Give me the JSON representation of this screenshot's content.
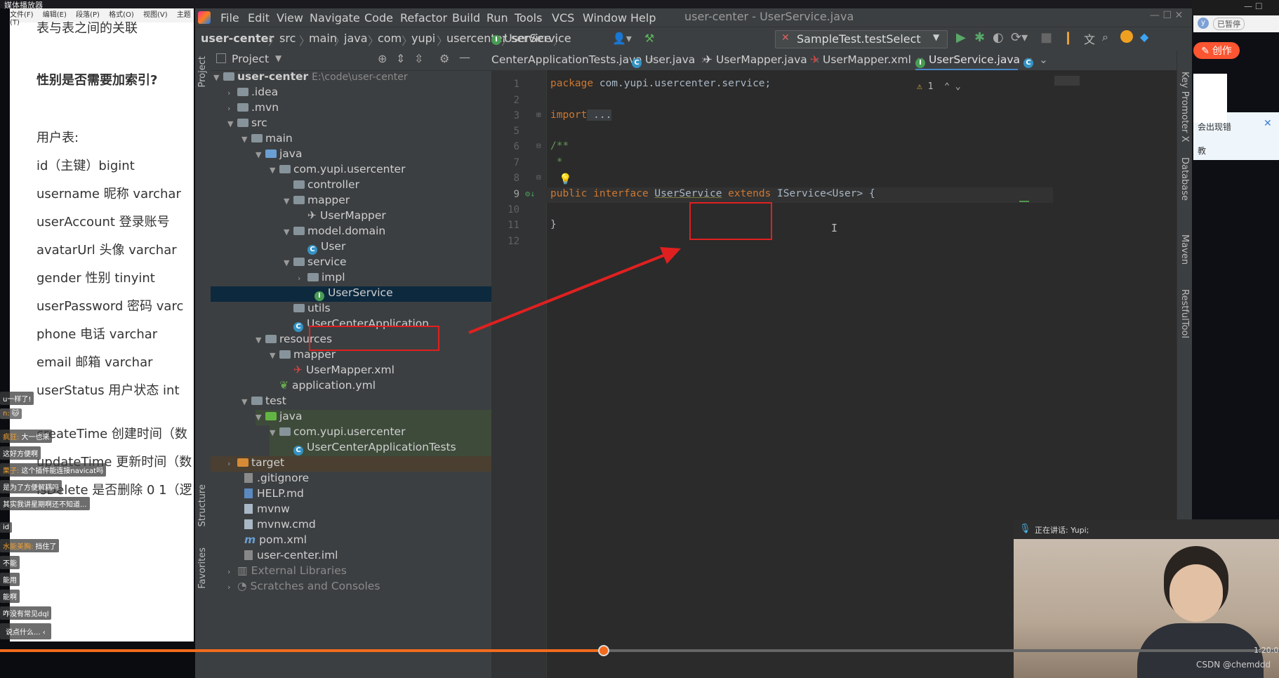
{
  "player": {
    "title": "媒体播放器"
  },
  "doc": {
    "menu": [
      "文件(F)",
      "编辑(E)",
      "段落(P)",
      "格式(O)",
      "视图(V)",
      "主题(T)"
    ],
    "heading_top": "表与表之间的关联",
    "question": "性别是否需要加索引?",
    "table_title": "用户表:",
    "fields": [
      "id（主键）bigint",
      "username 昵称  varchar",
      "userAccount 登录账号",
      "avatarUrl 头像 varchar",
      "gender 性别 tinyint",
      "userPassword 密码  varc",
      "phone 电话 varchar",
      "email 邮箱 varchar",
      "userStatus 用户状态 int",
      "createTime 创建时间（数",
      "updateTime 更新时间（数",
      "isDelete 是否删除 0 1（逻"
    ]
  },
  "danmaku": [
    {
      "text": "u一样了!"
    },
    {
      "name": "n:",
      "text": ""
    },
    {
      "name": "疯狂:",
      "text": "大一也来"
    },
    {
      "text": "这好方便啊"
    },
    {
      "name": "栗子:",
      "text": "这个插件能连接navicat吗"
    },
    {
      "text": "是为了方便解耦吗"
    },
    {
      "text": "其实我讲星期啊还不知道..."
    },
    {
      "text": "id"
    },
    {
      "name": "水能美胸:",
      "text": "挡住了"
    },
    {
      "text": "不能"
    },
    {
      "text": "能用"
    },
    {
      "text": "能啊"
    },
    {
      "text": "咋没有常见dql"
    },
    {
      "text": "说点什么..."
    }
  ],
  "ide": {
    "menu": [
      "File",
      "Edit",
      "View",
      "Navigate",
      "Code",
      "Refactor",
      "Build",
      "Run",
      "Tools",
      "VCS",
      "Window",
      "Help"
    ],
    "window_title": "user-center - UserService.java",
    "breadcrumbs": [
      "user-center",
      "src",
      "main",
      "java",
      "com",
      "yupi",
      "usercenter",
      "service",
      "UserService"
    ],
    "run_config": "SampleTest.testSelect",
    "project_label": "Project",
    "left_strip": [
      "Project",
      "Structure",
      "Favorites"
    ],
    "right_strip": [
      "Key Promoter X",
      "Database",
      "Maven",
      "RestfulTool"
    ],
    "tree": [
      {
        "label": "user-center",
        "extra": "E:\\code\\user-center"
      },
      {
        "label": ".idea"
      },
      {
        "label": ".mvn"
      },
      {
        "label": "src"
      },
      {
        "label": "main"
      },
      {
        "label": "java"
      },
      {
        "label": "com.yupi.usercenter"
      },
      {
        "label": "controller"
      },
      {
        "label": "mapper"
      },
      {
        "label": "UserMapper"
      },
      {
        "label": "model.domain"
      },
      {
        "label": "User"
      },
      {
        "label": "service"
      },
      {
        "label": "impl"
      },
      {
        "label": "UserService"
      },
      {
        "label": "utils"
      },
      {
        "label": "UserCenterApplication"
      },
      {
        "label": "resources"
      },
      {
        "label": "mapper"
      },
      {
        "label": "UserMapper.xml"
      },
      {
        "label": "application.yml"
      },
      {
        "label": "test"
      },
      {
        "label": "java"
      },
      {
        "label": "com.yupi.usercenter"
      },
      {
        "label": "UserCenterApplicationTests"
      },
      {
        "label": "target"
      },
      {
        "label": ".gitignore"
      },
      {
        "label": "HELP.md"
      },
      {
        "label": "mvnw"
      },
      {
        "label": "mvnw.cmd"
      },
      {
        "label": "pom.xml"
      },
      {
        "label": "user-center.iml"
      },
      {
        "label": "External Libraries"
      },
      {
        "label": "Scratches and Consoles"
      }
    ],
    "tabs": [
      "CenterApplicationTests.java",
      "User.java",
      "UserMapper.java",
      "UserMapper.xml",
      "UserService.java"
    ],
    "active_tab": "UserService.java",
    "line_numbers": [
      "1",
      "2",
      "3",
      "5",
      "6",
      "7",
      "8",
      "9",
      "10",
      "11",
      "12"
    ],
    "code": {
      "l1_kw": "package",
      "l1_rest": " com.yupi.usercenter.service;",
      "l3_kw": "import",
      "l3_rest": " ...",
      "l6": "/**",
      "l7": " *",
      "l9_kw1": "public",
      "l9_kw2": " interface ",
      "l9_name": "UserService",
      "l9_kw3": " extends ",
      "l9_rest": "IService<User> {",
      "l11": "}"
    },
    "warning_count": "1"
  },
  "browser": {
    "create_button": "创作",
    "tooltip_text": "会出现错",
    "tooltip_2": "教",
    "side_text": "已暂停"
  },
  "cam": {
    "speaking": "正在讲话: Yupi;"
  },
  "video": {
    "time": "1:20:0",
    "watermark": "CSDN @chemddd"
  },
  "colors": {
    "accent": "#4a88c7",
    "selection": "#0d293e",
    "annotation": "#e02020",
    "progress": "#f26b1d"
  }
}
